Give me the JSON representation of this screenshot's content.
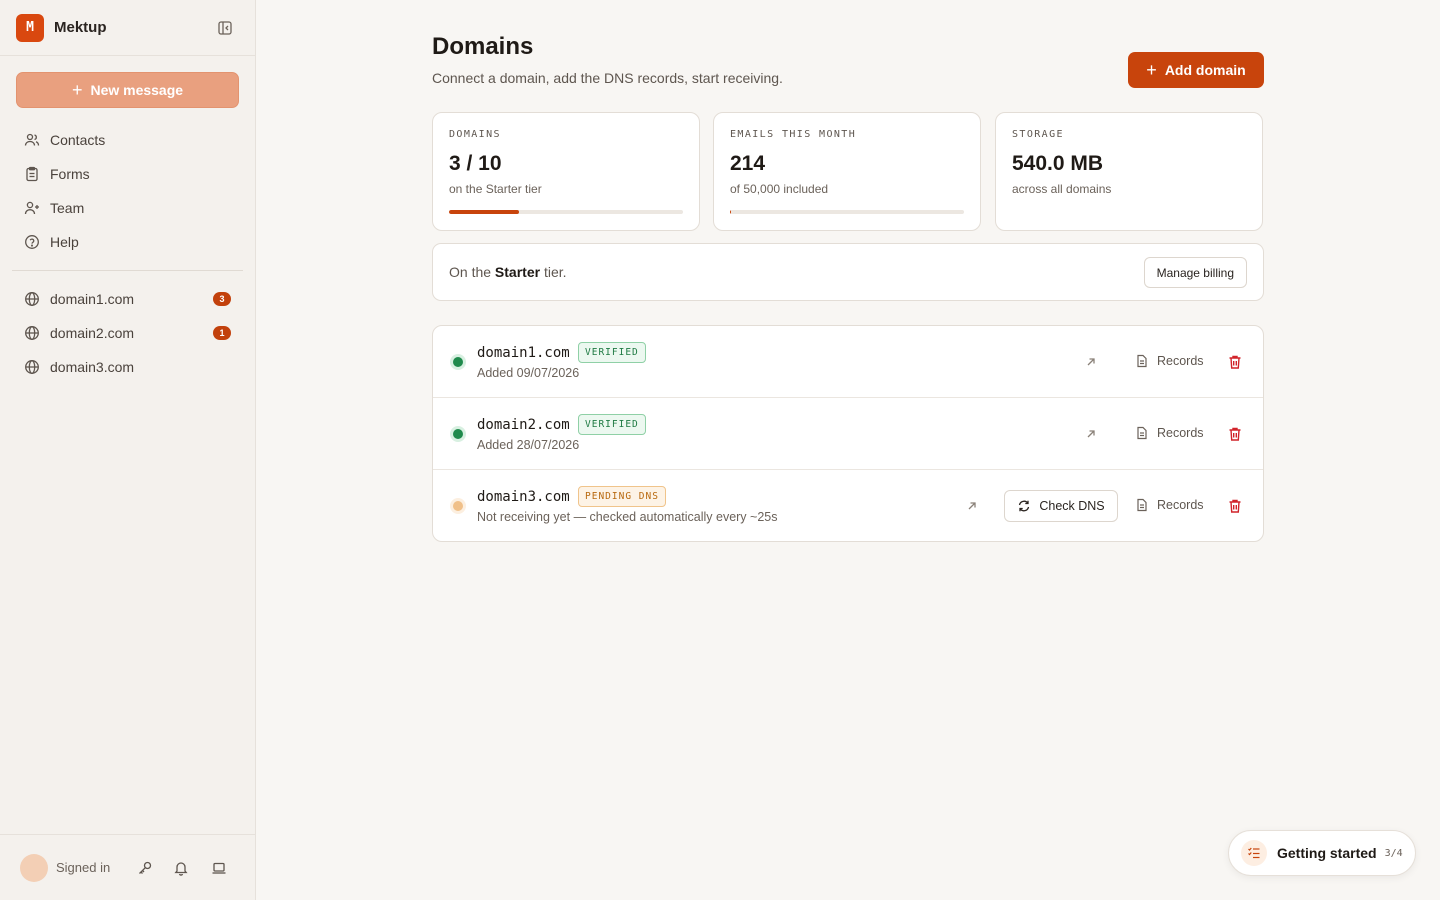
{
  "app": {
    "logo_letter": "M",
    "name": "Mektup"
  },
  "sidebar": {
    "new_message_label": "New message",
    "nav": [
      {
        "label": "Contacts",
        "icon": "users-icon"
      },
      {
        "label": "Forms",
        "icon": "clipboard-icon"
      },
      {
        "label": "Team",
        "icon": "user-plus-icon"
      },
      {
        "label": "Help",
        "icon": "help-circle-icon"
      }
    ],
    "domains": [
      {
        "label": "domain1.com",
        "badge": "3"
      },
      {
        "label": "domain2.com",
        "badge": "1"
      },
      {
        "label": "domain3.com",
        "badge": ""
      }
    ],
    "footer": {
      "signed_in": "Signed in"
    }
  },
  "header": {
    "title": "Domains",
    "subtitle": "Connect a domain, add the DNS records, start receiving.",
    "add_button": "Add domain"
  },
  "stats": [
    {
      "label": "DOMAINS",
      "value": "3 / 10",
      "sub": "on the Starter tier",
      "progress": 0.3
    },
    {
      "label": "EMAILS THIS MONTH",
      "value": "214",
      "sub": "of 50,000 included",
      "progress": 0.004
    },
    {
      "label": "STORAGE",
      "value": "540.0 MB",
      "sub": "across all domains"
    }
  ],
  "tier": {
    "prefix": "On the ",
    "name": "Starter",
    "suffix": " tier.",
    "button": "Manage billing"
  },
  "domain_list": [
    {
      "name": "domain1.com",
      "status": "VERIFIED",
      "sub": "Added 09/07/2026",
      "records": "Records"
    },
    {
      "name": "domain2.com",
      "status": "VERIFIED",
      "sub": "Added 28/07/2026",
      "records": "Records"
    },
    {
      "name": "domain3.com",
      "status": "PENDING DNS",
      "sub": "Not receiving yet — checked automatically every ~25s",
      "records": "Records",
      "check_dns": "Check DNS"
    }
  ],
  "getting_started": {
    "label": "Getting started",
    "count": "3/4"
  },
  "colors": {
    "accent": "#c8440c",
    "verified": "#1f8a4c",
    "pending": "#f0c089"
  }
}
